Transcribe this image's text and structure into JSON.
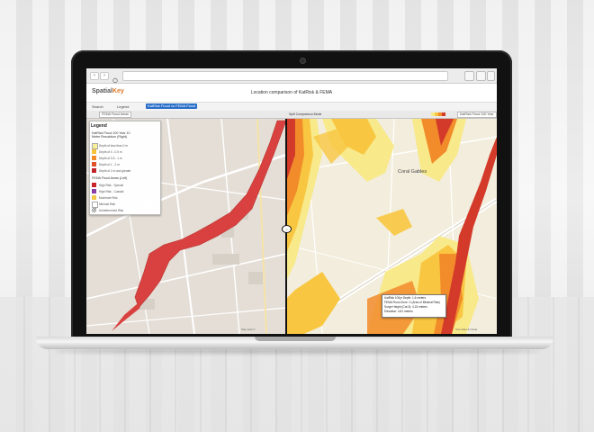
{
  "browser": {
    "back_glyph": "‹",
    "forward_glyph": "›"
  },
  "app": {
    "logo_prefix": "Spatial",
    "logo_suffix": "Key",
    "title": "Location comparison of KatRisk & FEMA",
    "toolbar": {
      "item1": "Search",
      "item2": "Legend",
      "active_button": "KatRisk Flood vs FEMA Flood"
    },
    "left_layer_select": "FEMA Flood Areas",
    "right_layer_select": "KatRisk Flood 100 Year",
    "compare_label": "Split Comparison Mode"
  },
  "legend": {
    "title": "Legend",
    "section1_title": [
      "KatRisk Flood 100 Year 10",
      "Meter Resolution (Right)"
    ],
    "section1_items": [
      {
        "label": "Depth of less than 0 m",
        "color": "#f7ef9a"
      },
      {
        "label": "Depth of 0 - 0.5 m",
        "color": "#f9c23c"
      },
      {
        "label": "Depth of 0.5 - 1 m",
        "color": "#f28b2a"
      },
      {
        "label": "Depth of 1 - 2 m",
        "color": "#e2502b"
      },
      {
        "label": "Depth of 2 m and greater",
        "color": "#c2222a"
      }
    ],
    "section2_title": "FEMA Flood Areas (Left)",
    "section2_items": [
      {
        "label": "High Risk - Special",
        "color": "#c9252b"
      },
      {
        "label": "High Risk - Coastal",
        "color": "#8a3fa3"
      },
      {
        "label": "Moderate Risk",
        "color": "#f2c84b"
      },
      {
        "label": "Minimal Risk",
        "color": "#ffffff"
      },
      {
        "label": "Undetermined Risk",
        "color": "#7a7a7a"
      }
    ]
  },
  "popup": {
    "lines": [
      "KatRisk 100yr Depth:  1.6 meters",
      "FEMA Flood Zone:  X (Area of Minimal Risk)",
      "Surge Height (Cat 3):  4.15 meters",
      "Elevation:  4.81 meters"
    ]
  },
  "map_labels": {
    "coral_gables": "Coral Gables",
    "left_attrib": "Map data ©",
    "right_attrib": "Tele Atlas & Nokia"
  },
  "colors": {
    "fema_high_risk": "#d8413f",
    "katrisk_deep": "#d33a2a",
    "katrisk_mid": "#f28b2a",
    "katrisk_shallow": "#f8c640",
    "katrisk_light": "#f8e98a"
  }
}
